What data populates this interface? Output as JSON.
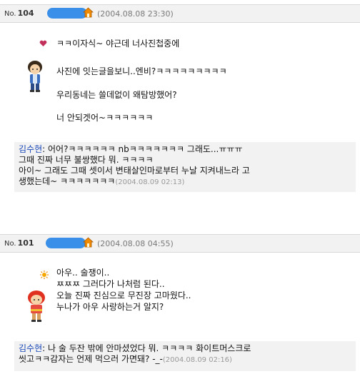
{
  "posts": [
    {
      "no_prefix": "No.",
      "no": "104",
      "date": "(2004.08.08 23:30)",
      "lines": [
        "ㅋㅋ이자식~ 야근데 너사진첩중에",
        "사진에 잇는글을보니..엔비?ㅋㅋㅋㅋㅋㅋㅋㅋㅋ",
        "우리동네는 쓸데없이 왜탐방했어?",
        "너 안되겟어~ㅋㅋㅋㅋㅋㅋ"
      ],
      "comment": {
        "author": "김수현",
        "text": ": 어어?ㅋㅋㅋㅋㅋㅋ nbㅋㅋㅋㅋㅋㅋㅋ 그래도...ㅠㅠㅠ\n그때 진짜 너무 불쌍했다 뭐. ㅋㅋㅋㅋ\n아이~ 그래도 그때 셋이서 변태살인마로부터 누날 지켜내느라 고\n생했는데~ ㅋㅋㅋㅋㅋㅋㅋ",
        "date": "(2004.08.09 02:13)"
      }
    },
    {
      "no_prefix": "No.",
      "no": "101",
      "date": "(2004.08.08 04:55)",
      "text": "아우.. 술쟁이..\nㅉㅉㅉ 그러다가 나처럼 된다..\n오늘 진짜 진심으로 무진장 고마웠다..\n누나가 아우 사랑하는거 알지?",
      "comment": {
        "author": "김수현",
        "text": ": 나 술 두잔 밖에 안마셨었다 뭐. ㅋㅋㅋㅋ 화이트머스크로\n씻고ㅋㅋ감자는 언제 먹으러 가면돼? -_-",
        "date": "(2004.08.09 02:16)"
      }
    }
  ],
  "colors": {
    "accent": "#3a8fe8",
    "author": "#1a48b8",
    "header_bg": "#f2f2f2",
    "icon_orange": "#f08a00"
  },
  "icons": [
    "heart-icon",
    "home-icon",
    "sun-icon",
    "avatar-boy",
    "avatar-girl"
  ]
}
